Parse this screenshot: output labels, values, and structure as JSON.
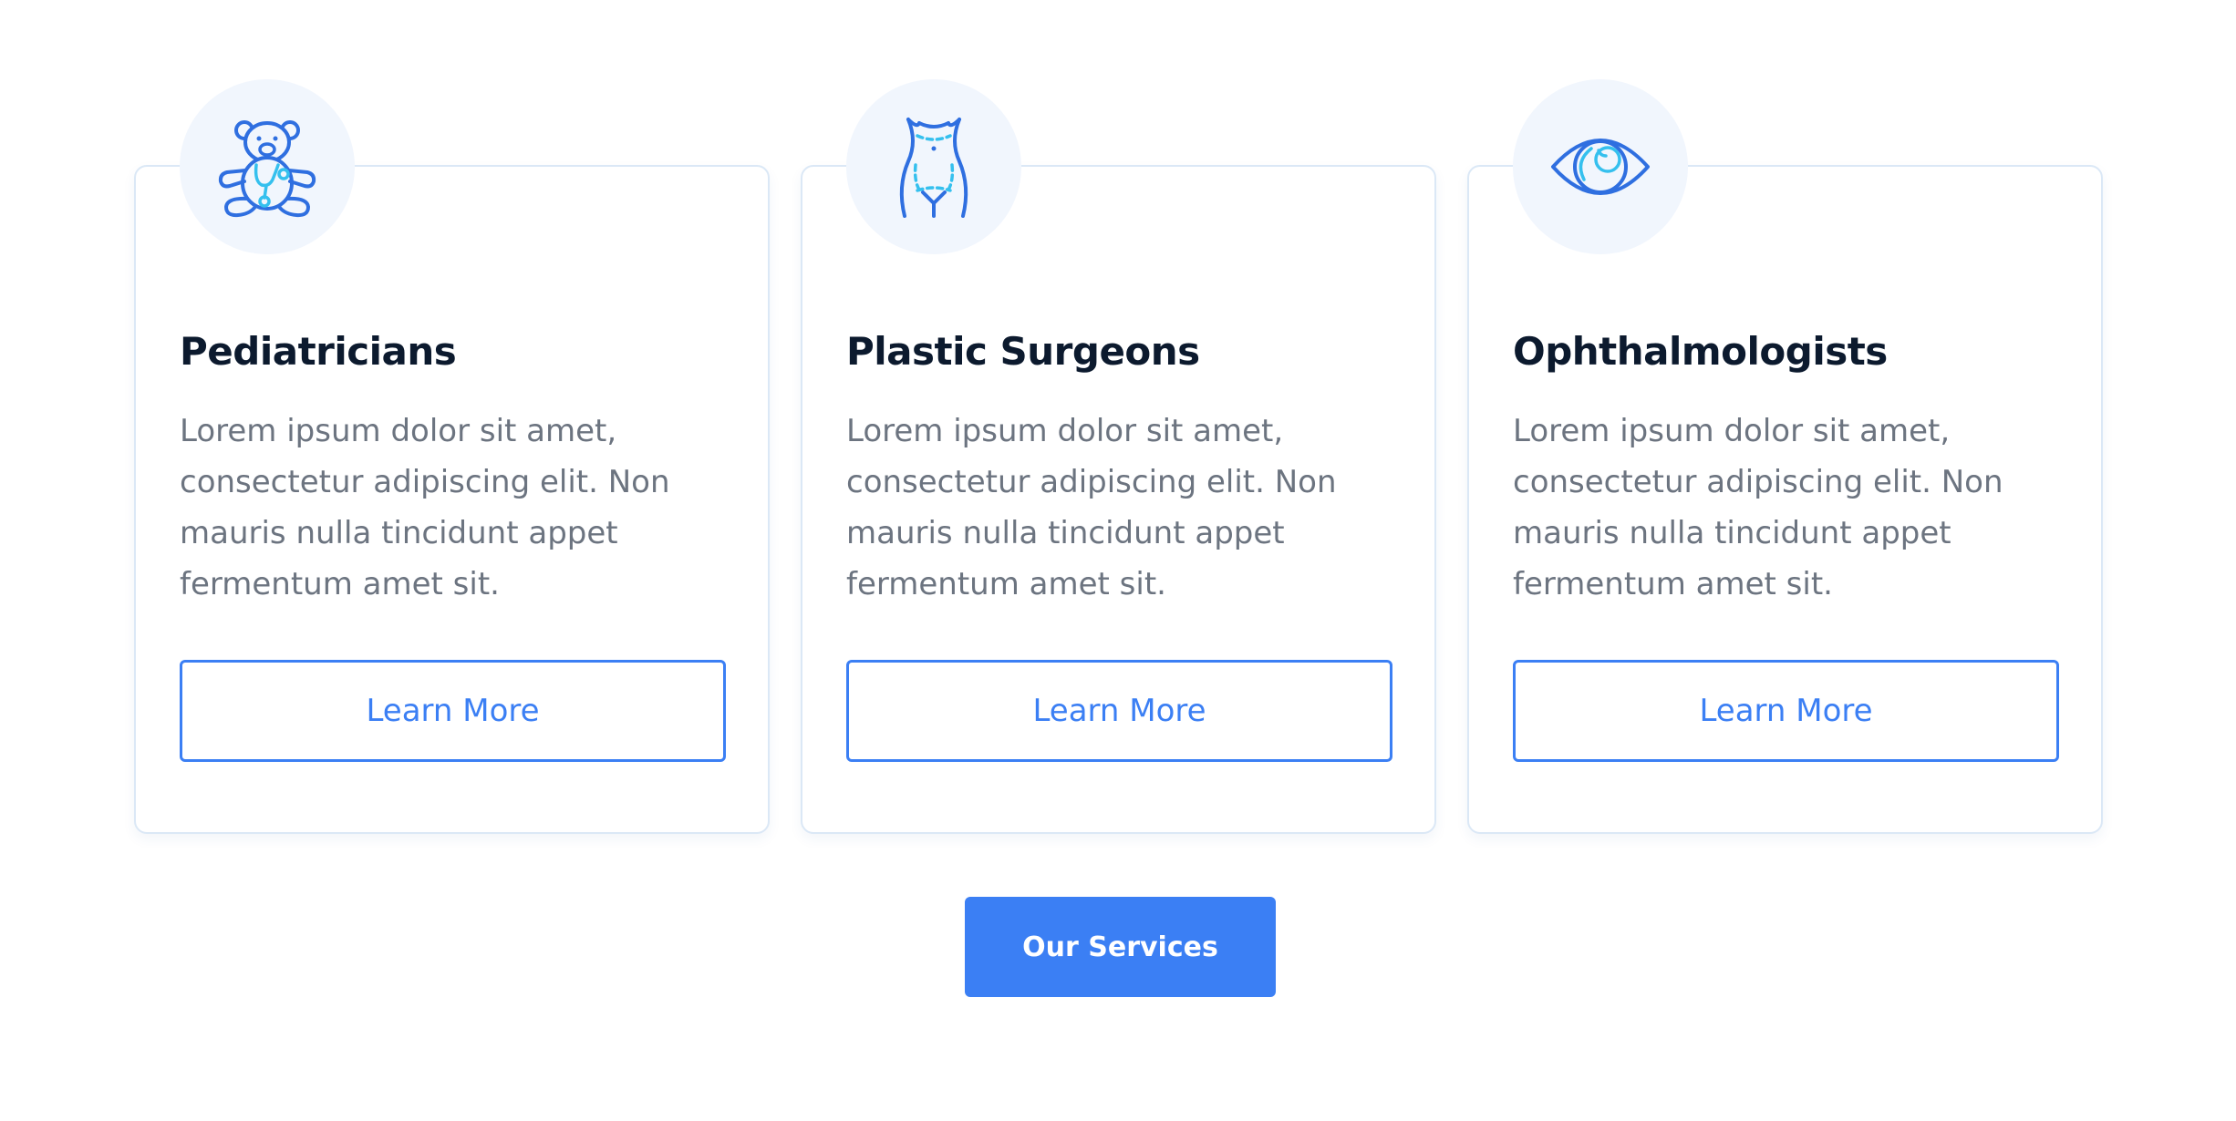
{
  "colors": {
    "accent": "#3b7ff4",
    "icon_dark": "#2f6fe0",
    "icon_light": "#35c0ee",
    "title": "#0c1a2e",
    "body_text": "#6c7480",
    "card_border": "#dbe8f6",
    "icon_bg": "#f1f6fd"
  },
  "cards": [
    {
      "icon": "teddy-bear-stethoscope-icon",
      "title": "Pediatricians",
      "text": "Lorem ipsum dolor sit amet, consectetur adipiscing elit. Non mauris nulla tincidunt appet fermentum amet sit.",
      "button_label": "Learn More"
    },
    {
      "icon": "torso-surgery-icon",
      "title": "Plastic Surgeons",
      "text": "Lorem ipsum dolor sit amet, consectetur adipiscing elit. Non mauris nulla tincidunt appet fermentum amet sit.",
      "button_label": "Learn More"
    },
    {
      "icon": "eye-icon",
      "title": "Ophthalmologists",
      "text": "Lorem ipsum dolor sit amet, consectetur adipiscing elit. Non mauris nulla tincidunt appet fermentum amet sit.",
      "button_label": "Learn More"
    }
  ],
  "services_button": {
    "label": "Our Services"
  }
}
